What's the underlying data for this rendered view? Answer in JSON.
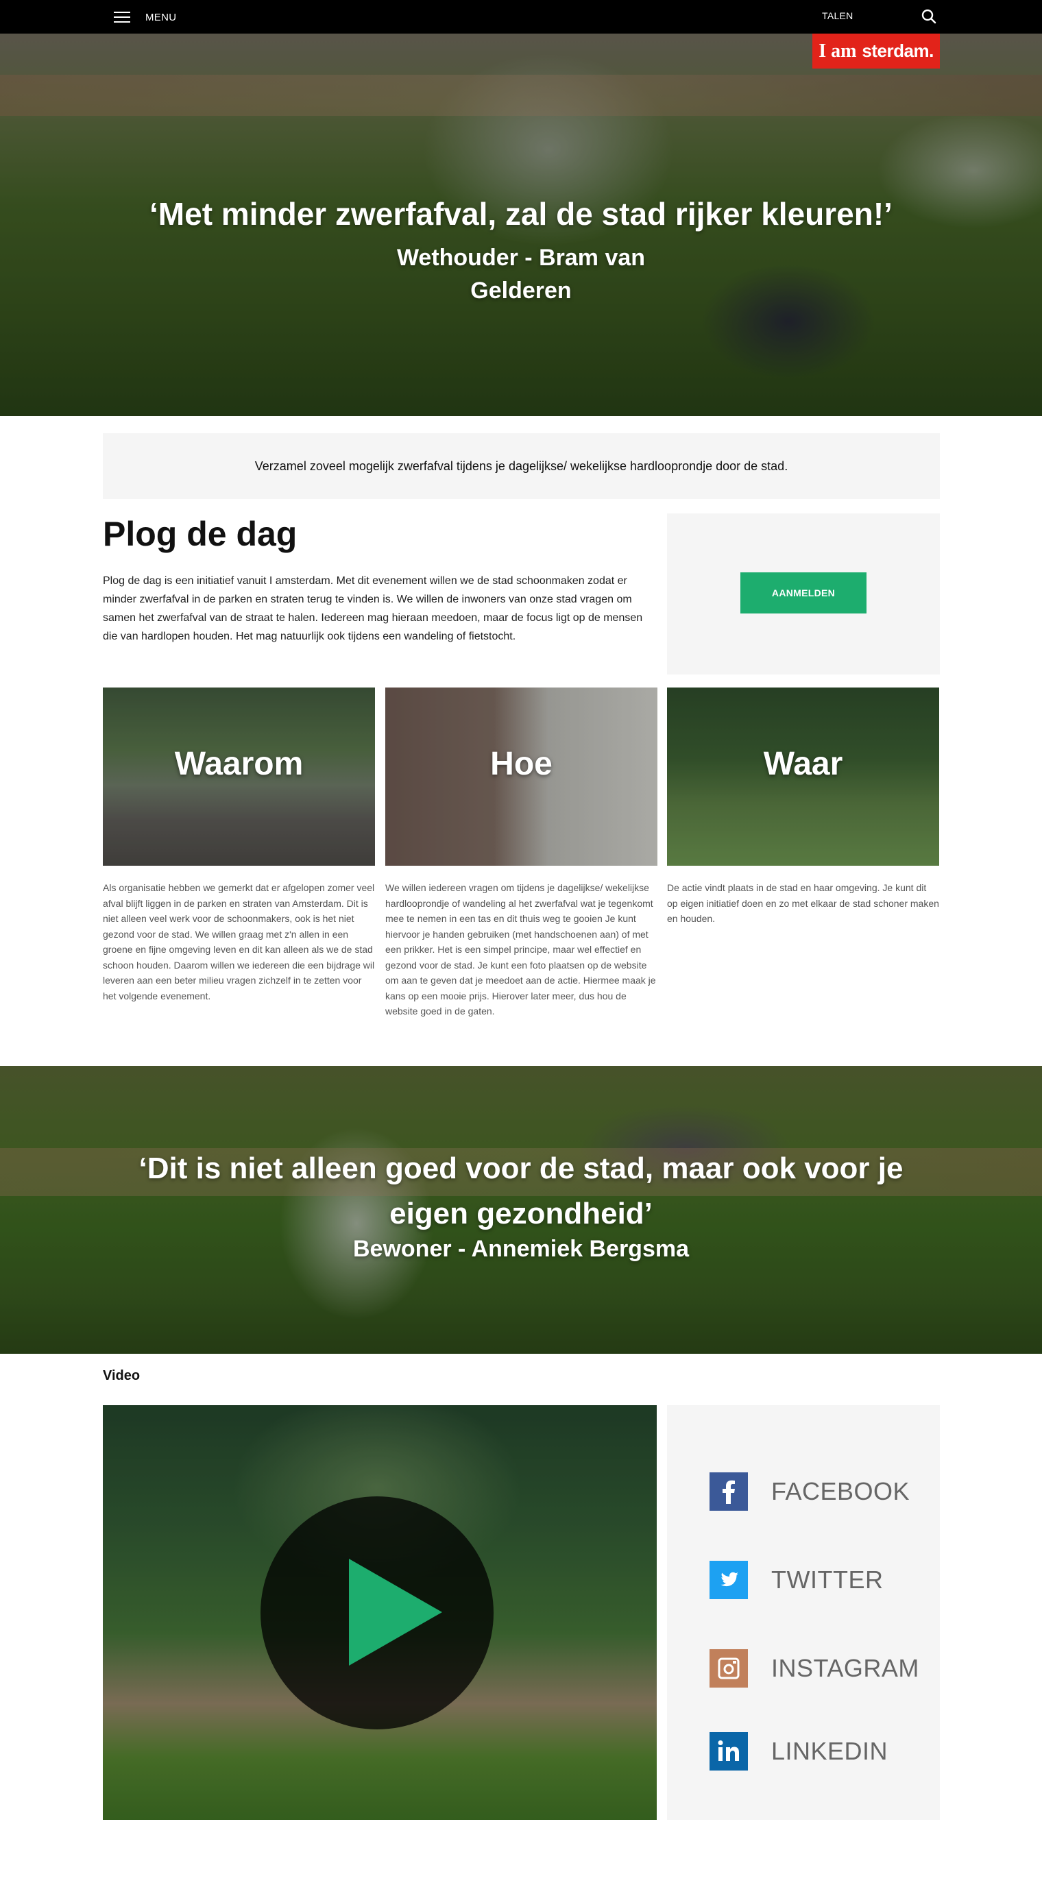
{
  "nav": {
    "menu_label": "MENU",
    "languages_label": "TALEN"
  },
  "logo": {
    "part1": "I am",
    "part2": "sterdam."
  },
  "hero": {
    "quote": "‘Met minder zwerfafval, zal de stad rijker kleuren!’",
    "author_line1": "Wethouder - Bram van",
    "author_line2": "Gelderen"
  },
  "intro": {
    "text": "Verzamel zoveel mogelijk zwerfafval tijdens je dagelijkse/ wekelijkse hardlooprondje door de stad."
  },
  "main": {
    "title": "Plog de dag",
    "paragraph": "Plog de dag is een initiatief vanuit I amsterdam. Met dit evenement willen we de stad schoonmaken zodat er minder zwerfafval in de parken en straten terug te vinden is. We willen de inwoners van onze stad vragen om samen het zwerfafval van de straat te halen. Iedereen mag hieraan meedoen, maar de focus ligt op de mensen die van hardlopen houden. Het mag natuurlijk ook tijdens een wandeling of fietstocht.",
    "signup_label": "AANMELDEN"
  },
  "cards": [
    {
      "title": "Waarom",
      "text": "Als organisatie hebben we gemerkt dat er afgelopen zomer veel afval blijft liggen in de parken en straten van Amsterdam. Dit is niet alleen veel werk voor de schoonmakers, ook is het niet gezond voor de stad. We willen graag met z'n allen in een groene en fijne omgeving leven en dit kan alleen als we de stad schoon houden. Daarom willen we iedereen die een bijdrage wil leveren aan een beter milieu vragen zichzelf in te zetten voor het volgende evenement."
    },
    {
      "title": "Hoe",
      "text": "We willen iedereen vragen om tijdens je dagelijkse/ wekelijkse hardlooprondje of wandeling al het zwerfafval wat je tegenkomt mee te nemen in een tas en dit thuis weg te gooien Je kunt hiervoor je handen gebruiken (met handschoenen aan) of met een prikker. Het is een simpel principe, maar wel effectief en gezond voor de stad. Je kunt een foto plaatsen op de website om aan te geven dat je meedoet aan de actie. Hiermee maak je kans op een mooie prijs. Hierover later meer, dus hou de website goed in de gaten."
    },
    {
      "title": "Waar",
      "text": "De actie vindt plaats in de stad en haar omgeving. Je kunt dit op eigen initiatief doen en zo met elkaar de stad schoner maken en houden."
    }
  ],
  "banner2": {
    "quote": "‘Dit is niet alleen goed voor de stad, maar ook voor je eigen gezondheid’",
    "author": "Bewoner - Annemiek Bergsma"
  },
  "video": {
    "label": "Video"
  },
  "social": [
    {
      "label": "FACEBOOK",
      "icon": "facebook-icon",
      "color": "#3b5998"
    },
    {
      "label": "TWITTER",
      "icon": "twitter-icon",
      "color": "#1da1f2"
    },
    {
      "label": "INSTAGRAM",
      "icon": "instagram-icon",
      "color": "#c1805b"
    },
    {
      "label": "LINKEDIN",
      "icon": "linkedin-icon",
      "color": "#0a66a8"
    }
  ],
  "colors": {
    "accent_green": "#1dad6e",
    "brand_red": "#e2231a",
    "topbar": "#000000",
    "panel_gray": "#f5f5f5"
  }
}
